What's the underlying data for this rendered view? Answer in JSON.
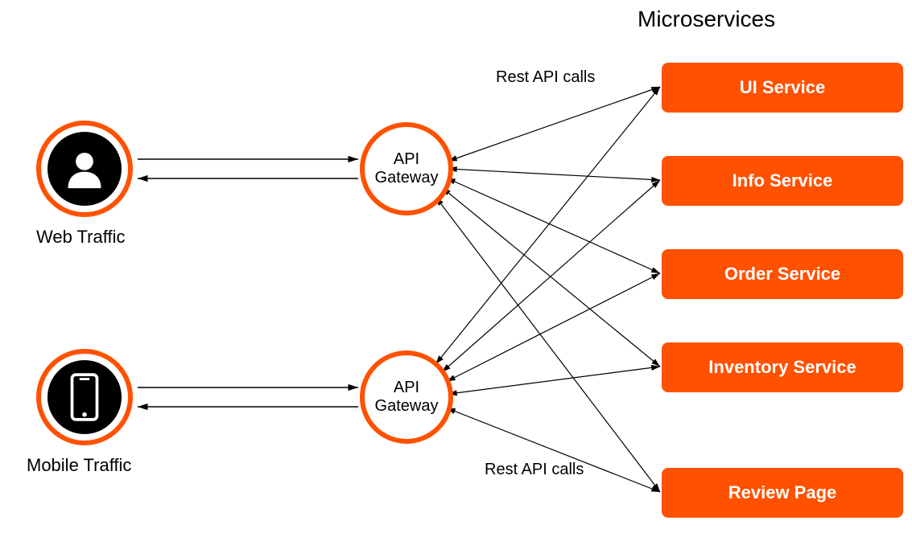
{
  "title": "Microservices",
  "clients": [
    {
      "label": "Web Traffic",
      "icon": "user"
    },
    {
      "label": "Mobile Traffic",
      "icon": "phone"
    }
  ],
  "gateways": [
    {
      "line1": "API",
      "line2": "Gateway"
    },
    {
      "line1": "API",
      "line2": "Gateway"
    }
  ],
  "services": [
    {
      "label": "UI Service"
    },
    {
      "label": "Info Service"
    },
    {
      "label": "Order Service"
    },
    {
      "label": "Inventory Service"
    },
    {
      "label": "Review Page"
    }
  ],
  "annotations": [
    {
      "text": "Rest API calls"
    },
    {
      "text": "Rest API calls"
    }
  ]
}
